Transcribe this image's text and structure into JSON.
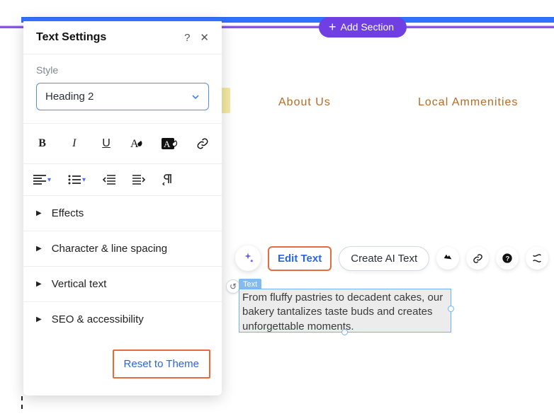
{
  "topbar": {
    "add_section": "Add Section"
  },
  "nav": {
    "about": "About Us",
    "local": "Local Ammenities"
  },
  "panel": {
    "title": "Text Settings",
    "style_label": "Style",
    "style_value": "Heading 2",
    "sections": {
      "effects": "Effects",
      "char_spacing": "Character & line spacing",
      "vertical": "Vertical text",
      "seo": "SEO & accessibility"
    },
    "reset": "Reset to Theme"
  },
  "floating": {
    "edit": "Edit Text",
    "ai": "Create AI Text"
  },
  "textblock": {
    "tag": "Text",
    "content": "From fluffy pastries to decadent cakes, our bakery tantalizes taste buds and creates unforgettable moments."
  }
}
